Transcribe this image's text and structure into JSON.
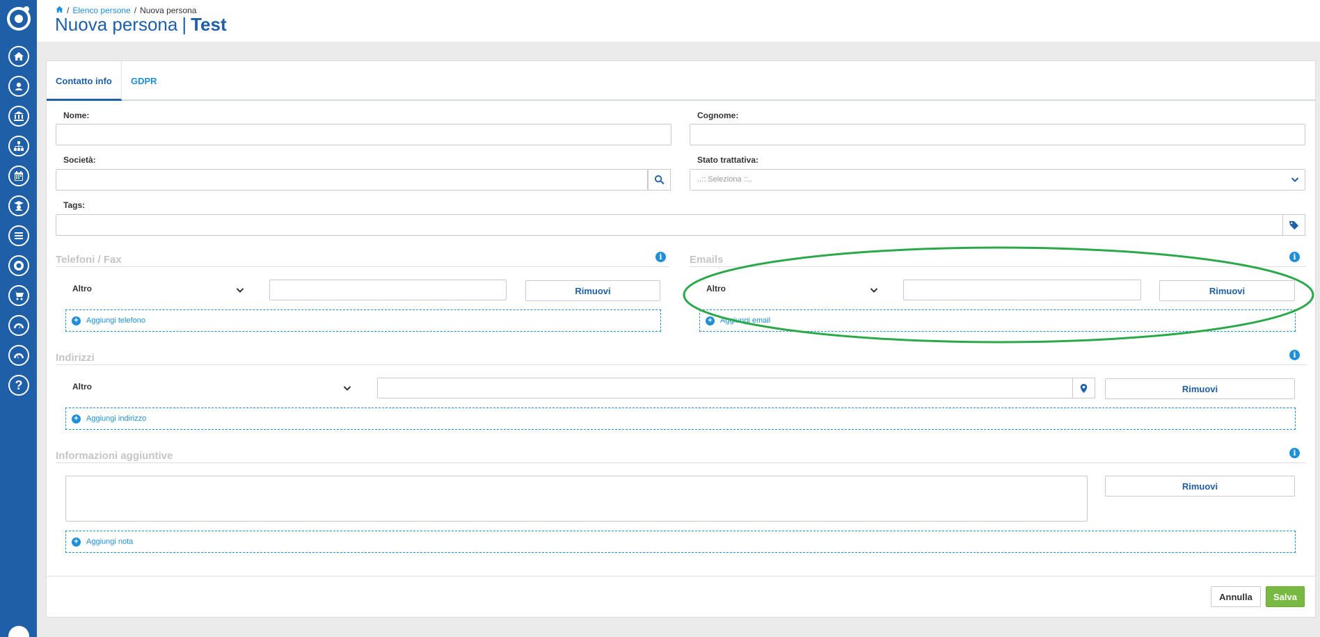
{
  "breadcrumb": {
    "parent": "Elenco persone",
    "separator": "/",
    "current": "Nuova persona"
  },
  "page_title": {
    "main": "Nuova persona",
    "separator": "|",
    "sub": "Test"
  },
  "tabs": [
    {
      "label": "Contatto info"
    },
    {
      "label": "GDPR"
    }
  ],
  "form": {
    "nome_label": "Nome:",
    "cognome_label": "Cognome:",
    "societa_label": "Società:",
    "stato_label": "Stato trattativa:",
    "stato_placeholder": "..:: Seleziona ::..",
    "tags_label": "Tags:"
  },
  "telefoni": {
    "title": "Telefoni / Fax",
    "type": "Altro",
    "remove": "Rimuovi",
    "add": "Aggiungi telefono"
  },
  "emails": {
    "title": "Emails",
    "type": "Altro",
    "remove": "Rimuovi",
    "add": "Aggiungi email"
  },
  "indirizzi": {
    "title": "Indirizzi",
    "type": "Altro",
    "remove": "Rimuovi",
    "add": "Aggiungi indirizzo"
  },
  "info": {
    "title": "Informazioni aggiuntive",
    "remove": "Rimuovi",
    "add": "Aggiungi nota"
  },
  "footer": {
    "cancel": "Annulla",
    "save": "Salva"
  },
  "colors": {
    "sidebar": "#1e5fa8",
    "accent": "#1f8fd8",
    "save": "#78b941",
    "annotation": "#2aa84a"
  },
  "sidebar_icons": [
    "home-icon",
    "contact-icon",
    "bank-icon",
    "org-chart-icon",
    "calendar-icon",
    "graduate-icon",
    "list-icon",
    "support-icon",
    "cart-icon",
    "gauge-icon",
    "gauge-alt-icon",
    "help-icon"
  ]
}
